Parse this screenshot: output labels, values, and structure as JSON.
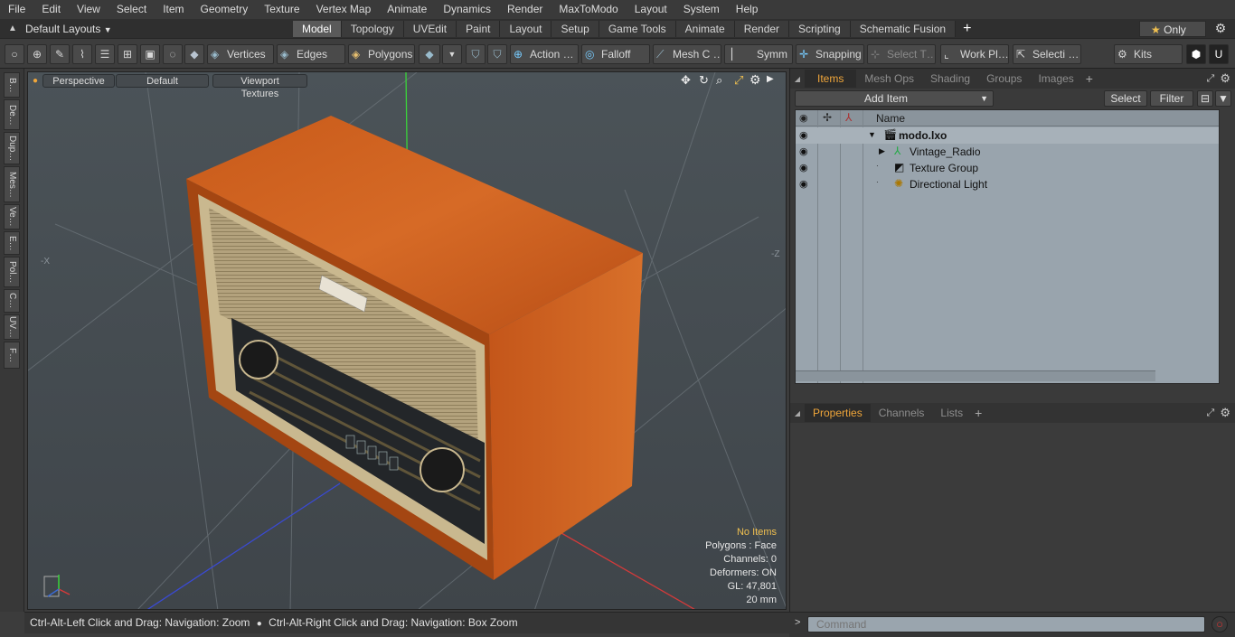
{
  "menu": [
    "File",
    "Edit",
    "View",
    "Select",
    "Item",
    "Geometry",
    "Texture",
    "Vertex Map",
    "Animate",
    "Dynamics",
    "Render",
    "MaxToModo",
    "Layout",
    "System",
    "Help"
  ],
  "layout": {
    "preset": "Default Layouts",
    "tabs": [
      "Model",
      "Topology",
      "UVEdit",
      "Paint",
      "Layout",
      "Setup",
      "Game Tools",
      "Animate",
      "Render",
      "Scripting",
      "Schematic Fusion"
    ],
    "active_tab": "Model",
    "only_label": "Only"
  },
  "toolbar": {
    "vertices": "Vertices",
    "edges": "Edges",
    "polygons": "Polygons",
    "action": "Action …",
    "falloff": "Falloff",
    "mesh": "Mesh C …",
    "symm": "Symm …",
    "snapping": "Snapping",
    "select_t": "Select T…",
    "work_pl": "Work Pl…",
    "selecti": "Selecti …",
    "kits": "Kits"
  },
  "left_tabs": [
    "B…",
    "De…",
    "Dup…",
    "Mes…",
    "Ve…",
    "E…",
    "Pol…",
    "C…",
    "UV…",
    "F…"
  ],
  "viewport": {
    "view": "Perspective",
    "shading": "Default",
    "textures": "Viewport Textures",
    "axis_neg_x": "-X",
    "axis_neg_z": "-Z",
    "info": {
      "selection": "No Items",
      "polygons": "Polygons : Face",
      "channels": "Channels: 0",
      "deformers": "Deformers: ON",
      "gl": "GL: 47,801",
      "units": "20 mm"
    },
    "colors": {
      "accent": "#f0a63a",
      "grid_x": "#d43a3a",
      "grid_y": "#3ad43a",
      "grid_z": "#3a4ad4"
    }
  },
  "status": {
    "hint1": "Ctrl-Alt-Left Click and Drag: Navigation: Zoom",
    "hint2": "Ctrl-Alt-Right Click and Drag: Navigation: Box Zoom"
  },
  "items_panel": {
    "tabs": [
      "Items",
      "Mesh Ops",
      "Shading",
      "Groups",
      "Images"
    ],
    "active_tab": "Items",
    "add_item": "Add Item",
    "select": "Select",
    "filter": "Filter",
    "column_name": "Name",
    "rows": [
      {
        "label": "modo.lxo",
        "icon": "scene-icon"
      },
      {
        "label": "Vintage_Radio",
        "icon": "mesh-icon"
      },
      {
        "label": "Texture Group",
        "icon": "texture-group-icon"
      },
      {
        "label": "Directional Light",
        "icon": "light-icon"
      }
    ]
  },
  "properties_panel": {
    "tabs": [
      "Properties",
      "Channels",
      "Lists"
    ],
    "active_tab": "Properties"
  },
  "command": {
    "placeholder": "Command"
  }
}
